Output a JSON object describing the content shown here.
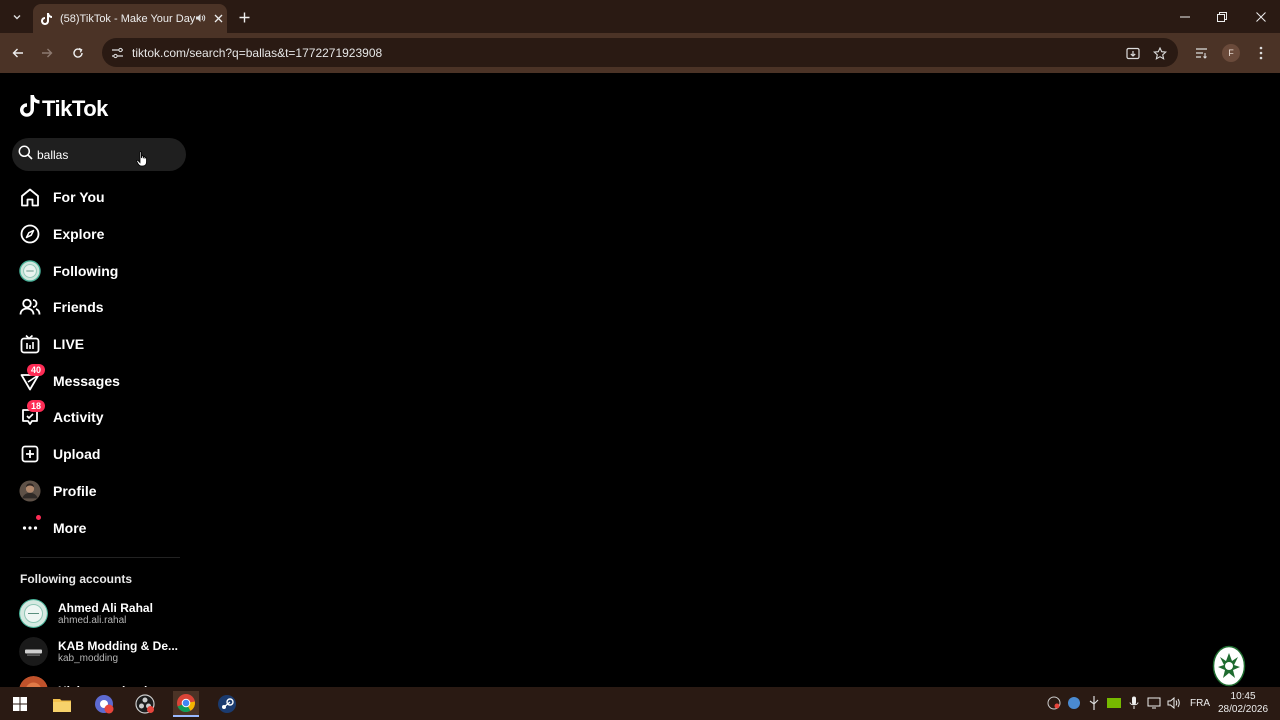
{
  "browser": {
    "tab_title": "(58)TikTok - Make Your Day",
    "url": "tiktok.com/search?q=ballas&t=1772271923908",
    "profile_initial": "F"
  },
  "tiktok": {
    "logo_text": "TikTok",
    "search_value": "ballas",
    "nav": [
      {
        "label": "For You"
      },
      {
        "label": "Explore"
      },
      {
        "label": "Following"
      },
      {
        "label": "Friends"
      },
      {
        "label": "LIVE"
      },
      {
        "label": "Messages",
        "badge": "40"
      },
      {
        "label": "Activity",
        "badge": "18"
      },
      {
        "label": "Upload"
      },
      {
        "label": "Profile"
      },
      {
        "label": "More"
      }
    ],
    "following_title": "Following accounts",
    "accounts": [
      {
        "name": "Ahmed Ali Rahal",
        "handle": "ahmed.ali.rahal"
      },
      {
        "name": "KAB Modding & De...",
        "handle": "kab_modding"
      },
      {
        "name": "Hichem technology",
        "handle": ""
      }
    ],
    "accent_color": "#fe2c55"
  },
  "taskbar": {
    "language": "FRA",
    "time": "10:45",
    "date": "28/02/2026"
  }
}
